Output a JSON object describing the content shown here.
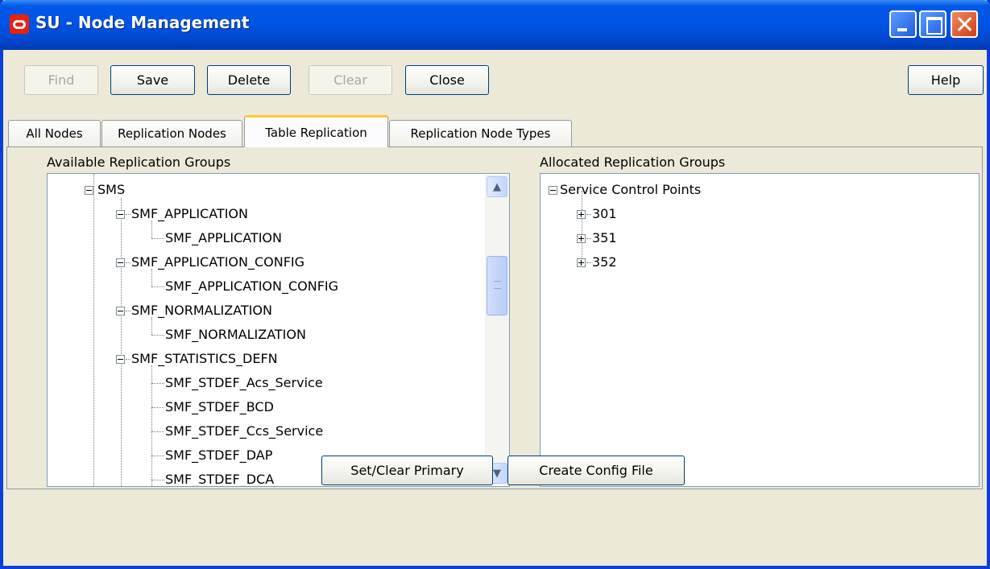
{
  "window": {
    "title": "SU - Node Management"
  },
  "toolbar": {
    "find": "Find",
    "save": "Save",
    "delete": "Delete",
    "clear": "Clear",
    "close": "Close",
    "help": "Help"
  },
  "tabs": [
    "All Nodes",
    "Replication Nodes",
    "Table Replication",
    "Replication Node Types"
  ],
  "active_tab": "Table Replication",
  "available": {
    "label": "Available Replication Groups",
    "items": [
      "SMS",
      "SMF_APPLICATION",
      "SMF_APPLICATION",
      "SMF_APPLICATION_CONFIG",
      "SMF_APPLICATION_CONFIG",
      "SMF_NORMALIZATION",
      "SMF_NORMALIZATION",
      "SMF_STATISTICS_DEFN",
      "SMF_STDEF_Acs_Service",
      "SMF_STDEF_BCD",
      "SMF_STDEF_Ccs_Service",
      "SMF_STDEF_DAP",
      "SMF_STDEF_DCA"
    ]
  },
  "allocated": {
    "label": "Allocated Replication Groups",
    "root": "Service Control Points",
    "children": [
      "301",
      "351",
      "352"
    ]
  },
  "bottom": {
    "set_clear_primary": "Set/Clear Primary",
    "create_config_file": "Create Config File"
  },
  "colors": {
    "title_bar": "#0054e3",
    "active_tab_accent": "#ffc83c",
    "panel_bg": "#ece9d8"
  }
}
